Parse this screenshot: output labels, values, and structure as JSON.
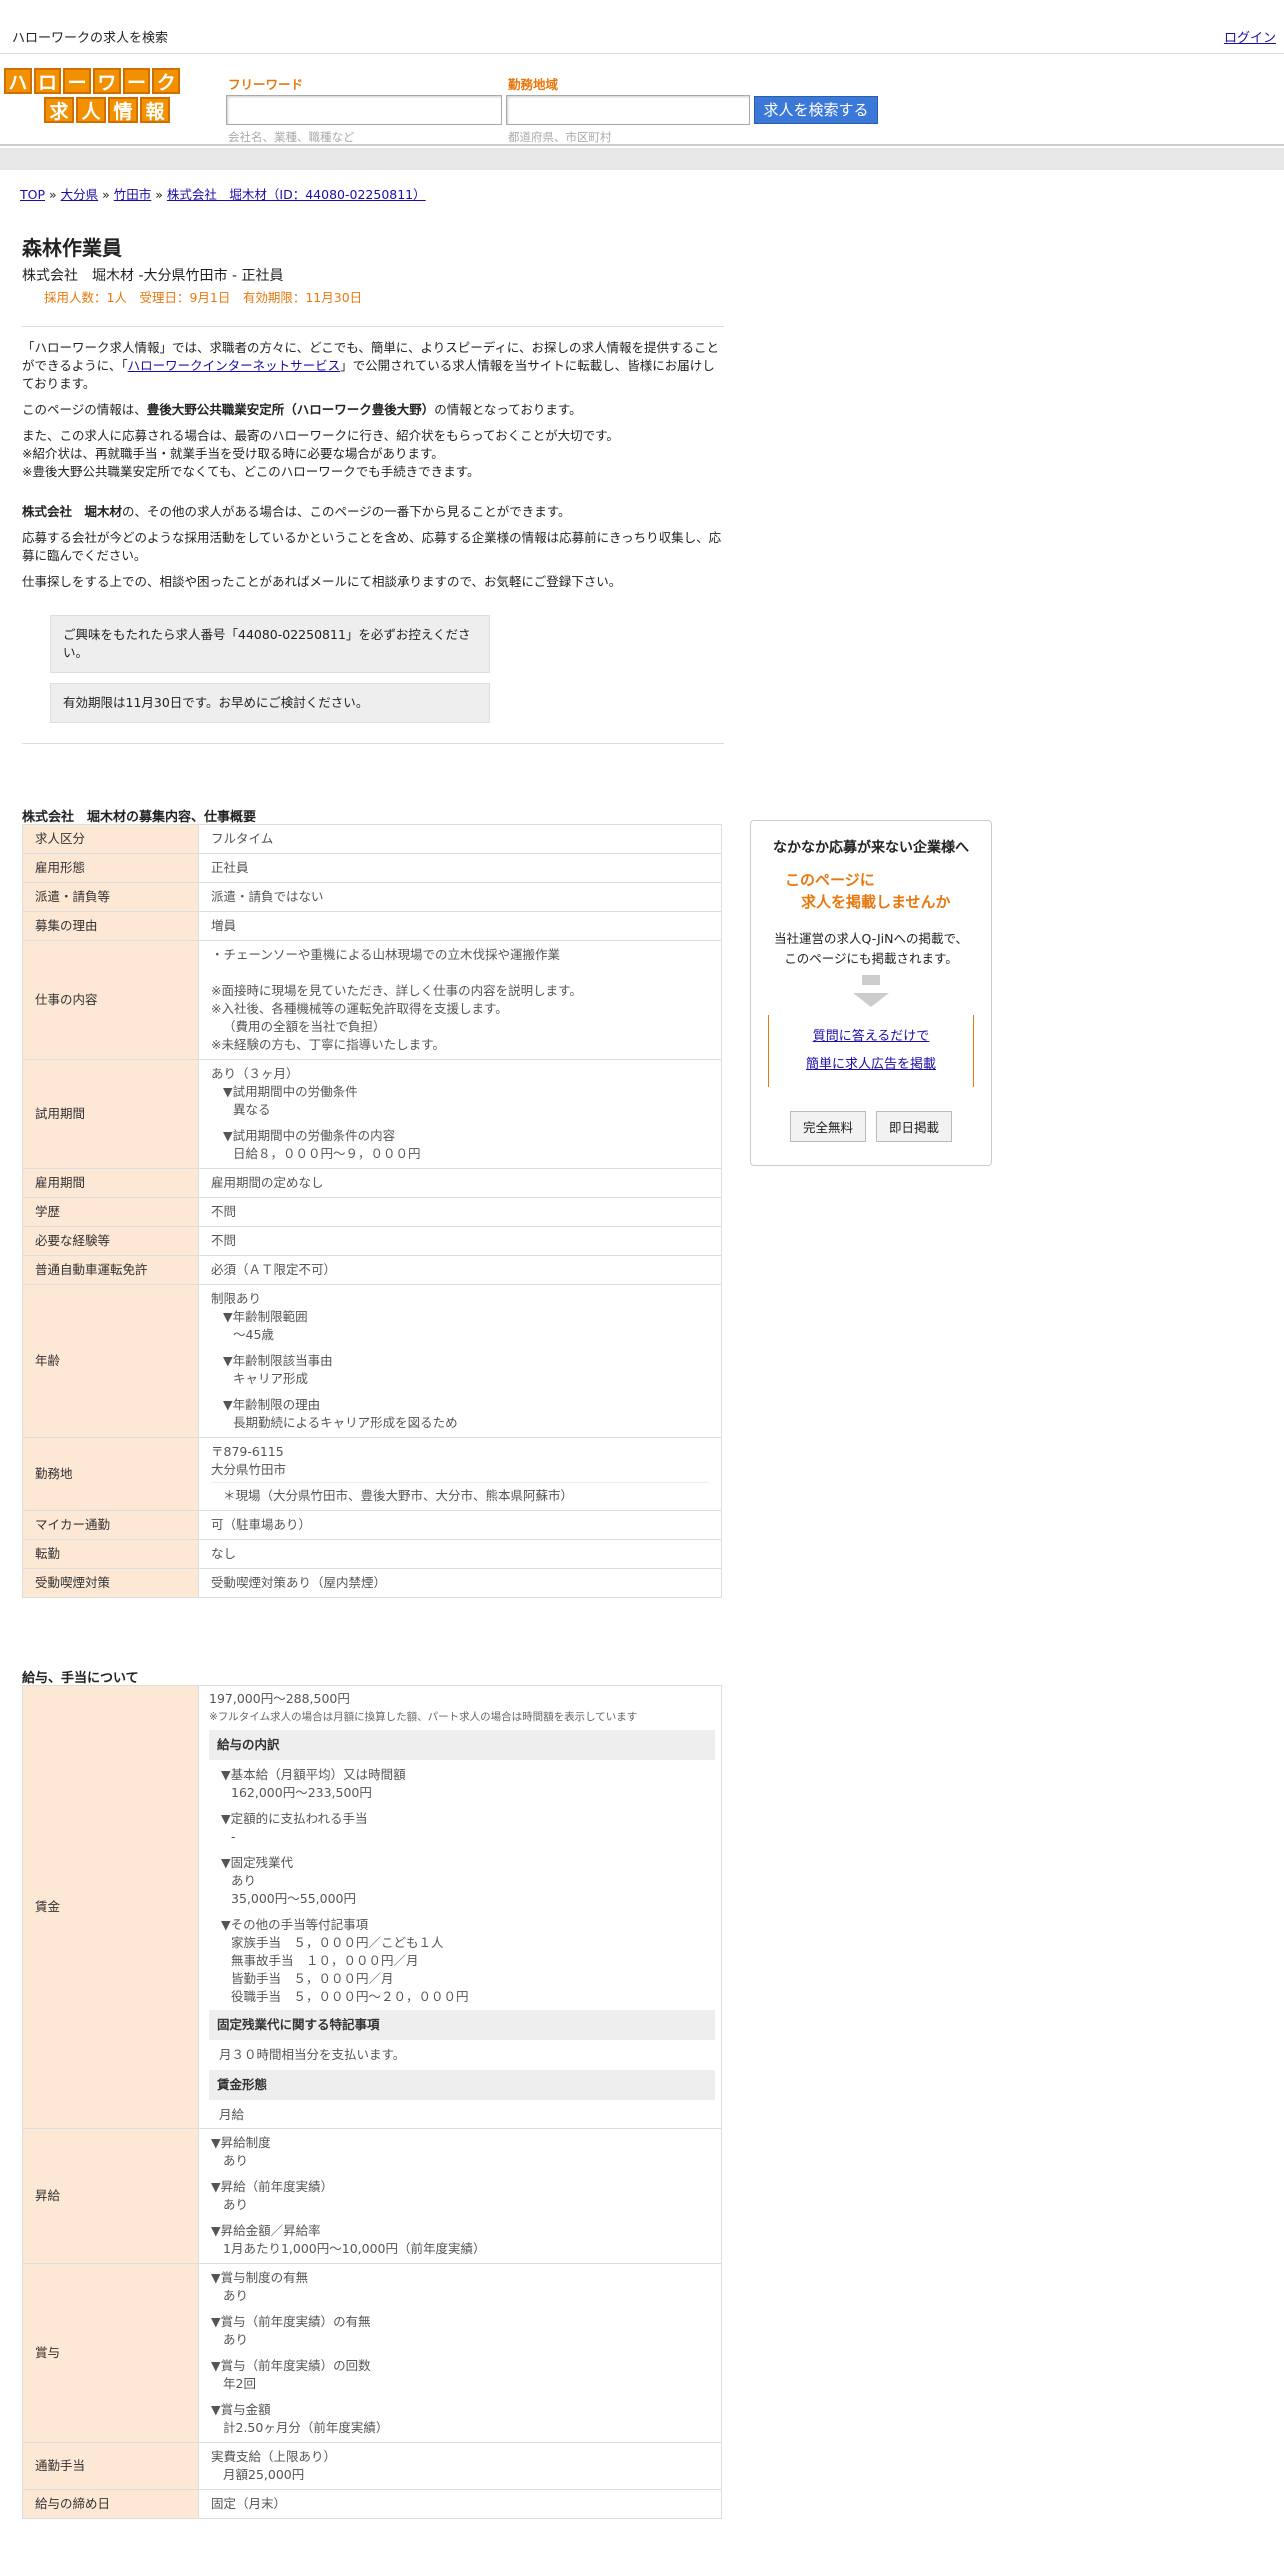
{
  "topbar": {
    "site_title": "ハローワークの求人を検索",
    "login": "ログイン"
  },
  "logo": {
    "row1": [
      "ハ",
      "ロ",
      "ー",
      "ワ",
      "ー",
      "ク"
    ],
    "row2": [
      "求",
      "人",
      "情",
      "報"
    ]
  },
  "search": {
    "keyword_label": "フリーワード",
    "keyword_hint": "会社名、業種、職種など",
    "area_label": "勤務地域",
    "area_hint": "都道府県、市区町村",
    "button": "求人を検索する"
  },
  "breadcrumb": {
    "top": "TOP",
    "pref": "大分県",
    "city": "竹田市",
    "company": "株式会社　堀木材（ID：44080-02250811）",
    "sep": "»"
  },
  "job": {
    "title": "森林作業員",
    "subtitle": "株式会社　堀木材 -大分県竹田市 - 正社員",
    "meta": "採用人数：1人　受理日：9月1日　有効期限：11月30日"
  },
  "intro": {
    "p1a": "「ハローワーク求人情報」では、求職者の方々に、どこでも、簡単に、よりスピーディに、お探しの求人情報を提供することができるように、「",
    "p1link": "ハローワークインターネットサービス",
    "p1b": "」で公開されている求人情報を当サイトに転載し、皆様にお届けしております。",
    "p2a": "このページの情報は、",
    "p2b": "豊後大野公共職業安定所（ハローワーク豊後大野）",
    "p2c": "の情報となっております。",
    "p3l1": "また、この求人に応募される場合は、最寄のハローワークに行き、紹介状をもらっておくことが大切です。",
    "p3l2": "※紹介状は、再就職手当・就業手当を受け取る時に必要な場合があります。",
    "p3l3": "※豊後大野公共職業安定所でなくても、どこのハローワークでも手続きできます。",
    "p4a": "株式会社　堀木材",
    "p4b": "の、その他の求人がある場合は、このページの一番下から見ることができます。",
    "p5": "応募する会社が今どのような採用活動をしているかということを含め、応募する企業様の情報は応募前にきっちり収集し、応募に臨んでください。",
    "p6": "仕事探しをする上での、相談や困ったことがあればメールにて相談承りますので、お気軽にご登録下さい。",
    "notice1": "ご興味をもたれたら求人番号「44080-02250811」を必ずお控えください。",
    "notice2": "有効期限は11月30日です。お早めにご検討ください。"
  },
  "section1": {
    "title": "株式会社　堀木材の募集内容、仕事概要",
    "rows": {
      "kubun": {
        "k": "求人区分",
        "v": "フルタイム"
      },
      "keitai": {
        "k": "雇用形態",
        "v": "正社員"
      },
      "haken": {
        "k": "派遣・請負等",
        "v": "派遣・請負ではない"
      },
      "riyu": {
        "k": "募集の理由",
        "v": "増員"
      },
      "naiyo": {
        "k": "仕事の内容",
        "l1": "・チェーンソーや重機による山林現場での立木伐採や運搬作業",
        "l2": "※面接時に現場を見ていただき、詳しく仕事の内容を説明します。",
        "l3": "※入社後、各種機械等の運転免許取得を支援します。",
        "l4": "（費用の全額を当社で負担）",
        "l5": "※未経験の方も、丁寧に指導いたします。"
      },
      "shiyo": {
        "k": "試用期間",
        "l1": "あり（３ヶ月）",
        "l2": "▼試用期間中の労働条件",
        "l3": "異なる",
        "l4": "▼試用期間中の労働条件の内容",
        "l5": "日給８，０００円～９，０００円"
      },
      "koyokikan": {
        "k": "雇用期間",
        "v": "雇用期間の定めなし"
      },
      "gakureki": {
        "k": "学歴",
        "v": "不問"
      },
      "keiken": {
        "k": "必要な経験等",
        "v": "不問"
      },
      "menkyo": {
        "k": "普通自動車運転免許",
        "v": "必須（ＡＴ限定不可）"
      },
      "nenrei": {
        "k": "年齢",
        "l1": "制限あり",
        "l2": "▼年齢制限範囲",
        "l3": "〜45歳",
        "l4": "▼年齢制限該当事由",
        "l5": "キャリア形成",
        "l6": "▼年齢制限の理由",
        "l7": "長期勤続によるキャリア形成を図るため"
      },
      "kinmuchi": {
        "k": "勤務地",
        "l1": "〒879-6115",
        "l2": "大分県竹田市",
        "l3": "＊現場（大分県竹田市、豊後大野市、大分市、熊本県阿蘇市）"
      },
      "mycar": {
        "k": "マイカー通勤",
        "v": "可（駐車場あり）"
      },
      "tenkin": {
        "k": "転勤",
        "v": "なし"
      },
      "kitsuen": {
        "k": "受動喫煙対策",
        "v": "受動喫煙対策あり（屋内禁煙）"
      }
    }
  },
  "section2": {
    "title": "給与、手当について",
    "chingin": {
      "k": "賃金",
      "range": "197,000円〜288,500円",
      "note": "※フルタイム求人の場合は月額に換算した額、パート求人の場合は時間額を表示しています",
      "sub1": "給与の内訳",
      "b1": "▼基本給（月額平均）又は時間額",
      "b1v": "162,000円〜233,500円",
      "b2": "▼定額的に支払われる手当",
      "b2v": "-",
      "b3": "▼固定残業代",
      "b3v1": "あり",
      "b3v2": "35,000円〜55,000円",
      "b4": "▼その他の手当等付記事項",
      "b4v1": "家族手当　５，０００円／こども１人",
      "b4v2": "無事故手当　１０，０００円／月",
      "b4v3": "皆勤手当　５，０００円／月",
      "b4v4": "役職手当　５，０００円～２０，０００円",
      "sub2": "固定残業代に関する特記事項",
      "s2v": "月３０時間相当分を支払います。",
      "sub3": "賃金形態",
      "s3v": "月給"
    },
    "shokyu": {
      "k": "昇給",
      "l1": "▼昇給制度",
      "l2": "あり",
      "l3": "▼昇給（前年度実績）",
      "l4": "あり",
      "l5": "▼昇給金額／昇給率",
      "l6": "1月あたり1,000円〜10,000円（前年度実績）"
    },
    "shoyo": {
      "k": "賞与",
      "l1": "▼賞与制度の有無",
      "l2": "あり",
      "l3": "▼賞与（前年度実績）の有無",
      "l4": "あり",
      "l5": "▼賞与（前年度実績）の回数",
      "l6": "年2回",
      "l7": "▼賞与金額",
      "l8": "計2.50ヶ月分（前年度実績）"
    },
    "tsukin": {
      "k": "通勤手当",
      "l1": "実費支給（上限あり）",
      "l2": "月額25,000円"
    },
    "shime": {
      "k": "給与の締め日",
      "v": "固定（月末）"
    }
  },
  "ad": {
    "heading": "なかなか応募が来ない企業様へ",
    "orange1": "このページに",
    "orange2": "求人を掲載しませんか",
    "desc1": "当社運営の求人Q-JiNへの掲載で、",
    "desc2": "このページにも掲載されます。",
    "link1": "質問に答えるだけで",
    "link2": "簡単に求人広告を掲載",
    "btn1": "完全無料",
    "btn2": "即日掲載"
  }
}
